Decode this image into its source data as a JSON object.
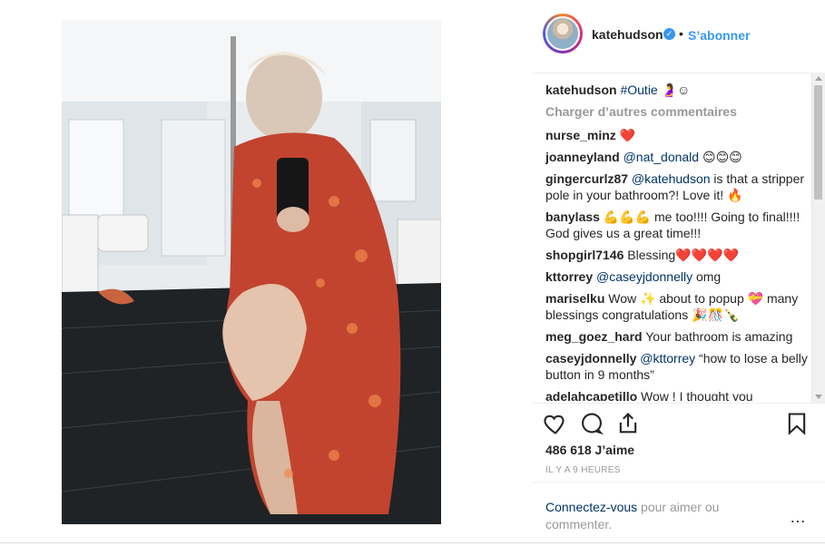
{
  "post": {
    "username": "katehudson",
    "follow_label": "S’abonner",
    "caption_hashtag": "#Outie",
    "caption_emoji": "🤰☺",
    "load_more": "Charger d’autres commentaires",
    "likes": "486 618 J’aime",
    "time": "IL Y A 9 HEURES",
    "login_link": "Connectez-vous",
    "login_text": " pour aimer ou commenter.",
    "more": "…"
  },
  "comments": [
    {
      "user": "nurse_minz",
      "text": "❤️",
      "heart": true
    },
    {
      "user": "joanneyland",
      "mention": "@nat_donald",
      "text": " 😊😊😊"
    },
    {
      "user": "gingercurlz87",
      "mention": "@katehudson",
      "text": " is that a stripper pole in your bathroom?! Love it! 🔥"
    },
    {
      "user": "banylass",
      "text": "💪💪💪 me too!!!! Going to final!!!! God gives us a great time!!!"
    },
    {
      "user": "shopgirl7146",
      "text": "Blessing❤️❤️❤️❤️"
    },
    {
      "user": "kttorrey",
      "mention": "@caseyjdonnelly",
      "text": " omg"
    },
    {
      "user": "mariselku",
      "text": "Wow ✨ about to popup 💝 many blessings congratulations 🎉🎊🍾"
    },
    {
      "user": "meg_goez_hard",
      "text": "Your bathroom is amazing"
    },
    {
      "user": "caseyjdonnelly",
      "mention": "@kttorrey",
      "text": " “how to lose a belly button in 9 months”"
    },
    {
      "user": "adelahcapetillo",
      "text": "Wow ! I thought you"
    }
  ],
  "icons": [
    "heart-icon",
    "comment-icon",
    "share-icon",
    "bookmark-icon",
    "verified-icon"
  ],
  "colors": {
    "link": "#3897f0",
    "mention": "#003569",
    "muted": "#999999",
    "text": "#262626"
  }
}
